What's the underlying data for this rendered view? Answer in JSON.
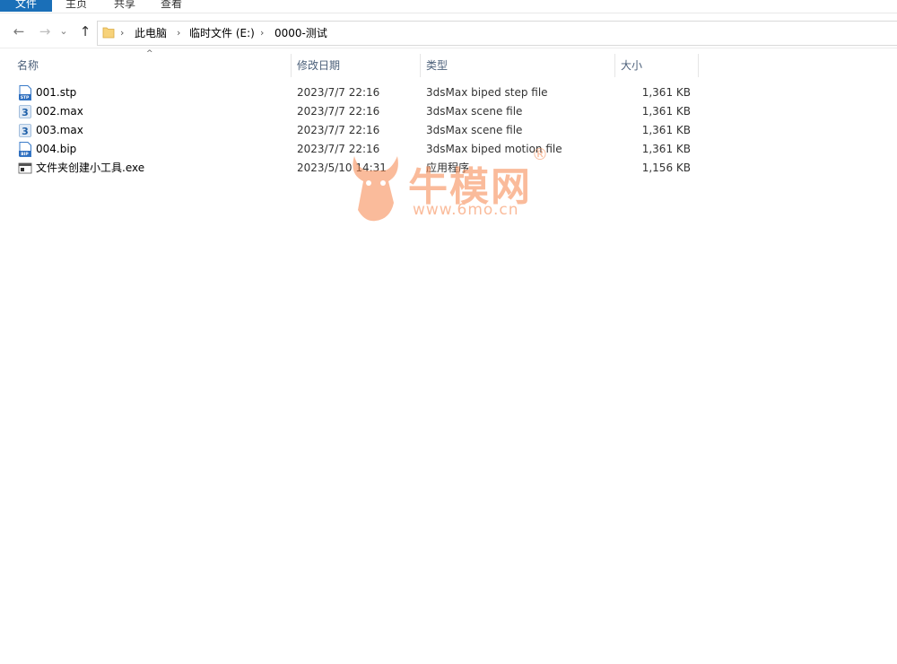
{
  "ribbon": {
    "tabs": [
      {
        "label": "文件",
        "active": true
      },
      {
        "label": "主页",
        "active": false
      },
      {
        "label": "共享",
        "active": false
      },
      {
        "label": "查看",
        "active": false
      }
    ],
    "accent": "#1a6fb8"
  },
  "nav": {
    "back_icon": "←",
    "forward_icon": "→",
    "recent_icon": "⌄",
    "up_icon": "↑"
  },
  "address": {
    "crumbs": [
      "此电脑",
      "临时文件 (E:)",
      "0000-测试"
    ],
    "separator": "›"
  },
  "columns": {
    "name": "名称",
    "date": "修改日期",
    "type": "类型",
    "size": "大小",
    "sort_indicator": "^"
  },
  "files": [
    {
      "name": "001.stp",
      "date": "2023/7/7 22:16",
      "type": "3dsMax biped step file",
      "size": "1,361 KB",
      "icon": "stp-file-icon"
    },
    {
      "name": "002.max",
      "date": "2023/7/7 22:16",
      "type": "3dsMax scene file",
      "size": "1,361 KB",
      "icon": "max-file-icon"
    },
    {
      "name": "003.max",
      "date": "2023/7/7 22:16",
      "type": "3dsMax scene file",
      "size": "1,361 KB",
      "icon": "max-file-icon"
    },
    {
      "name": "004.bip",
      "date": "2023/7/7 22:16",
      "type": "3dsMax biped motion file",
      "size": "1,361 KB",
      "icon": "bip-file-icon"
    },
    {
      "name": "文件夹创建小工具.exe",
      "date": "2023/5/10 14:31",
      "type": "应用程序",
      "size": "1,156 KB",
      "icon": "exe-file-icon"
    }
  ],
  "watermark": {
    "brand": "牛模网",
    "url": "www.6mo.cn",
    "registered": "®",
    "color": "#f6854a"
  }
}
